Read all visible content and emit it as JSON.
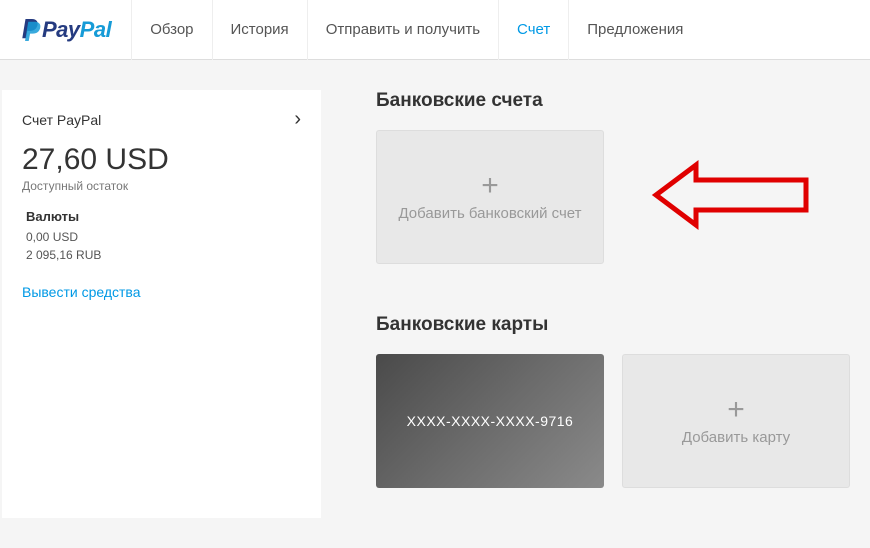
{
  "brand": {
    "name1": "Pay",
    "name2": "Pal"
  },
  "nav": {
    "overview": "Обзор",
    "history": "История",
    "send_receive": "Отправить и получить",
    "wallet": "Счет",
    "offers": "Предложения"
  },
  "sidebar": {
    "account_title": "Счет PayPal",
    "balance": "27,60 USD",
    "balance_label": "Доступный остаток",
    "currencies_label": "Валюты",
    "currencies": [
      "0,00 USD",
      "2 095,16 RUB"
    ],
    "withdraw": "Вывести средства"
  },
  "main": {
    "bank_accounts_title": "Банковские счета",
    "add_bank_account": "Добавить банковский счет",
    "cards_title": "Банковские карты",
    "card_masked": "XXXX-XXXX-XXXX-9716",
    "add_card": "Добавить карту"
  }
}
